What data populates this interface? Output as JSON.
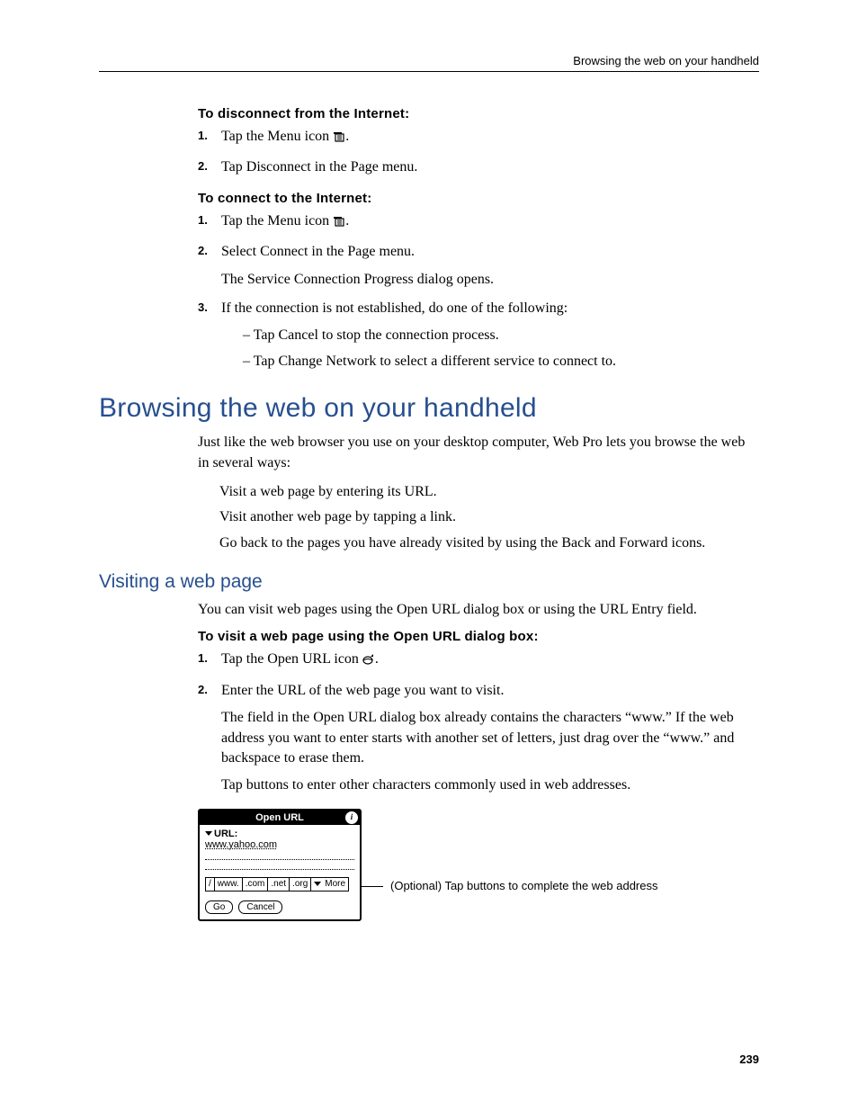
{
  "header": {
    "running": "Browsing the web on your handheld"
  },
  "proc1": {
    "title": "To disconnect from the Internet:",
    "s1": "Tap the Menu icon ",
    "s1_tail": ".",
    "s2": "Tap Disconnect in the Page menu."
  },
  "proc2": {
    "title": "To connect to the Internet:",
    "s1": "Tap the Menu icon ",
    "s1_tail": ".",
    "s2": "Select Connect in the Page menu.",
    "s2_follow": "The Service Connection Progress dialog opens.",
    "s3": "If the connection is not established, do one of the following:",
    "s3a": "Tap Cancel to stop the connection process.",
    "s3b": "Tap Change Network to select a different service to connect to."
  },
  "h1": "Browsing the web on your handheld",
  "intro": "Just like the web browser you use on your desktop computer, Web Pro lets you browse the web in several ways:",
  "b1": "Visit a web page by entering its URL.",
  "b2": "Visit another web page by tapping a link.",
  "b3": "Go back to the pages you have already visited by using the Back and Forward icons.",
  "h2": "Visiting a web page",
  "visit_intro": "You can visit web pages using the Open URL dialog box or using the URL Entry field.",
  "proc3": {
    "title": "To visit a web page using the Open URL dialog box:",
    "s1": "Tap the Open URL icon ",
    "s1_tail": ".",
    "s2": "Enter the URL of the web page you want to visit.",
    "s2_follow1": "The field in the Open URL dialog box already contains the characters “www.” If the web address you want to enter starts with another set of letters, just drag over the “www.” and backspace to erase them.",
    "s2_follow2": "Tap buttons to enter other characters commonly used in web addresses."
  },
  "dialog": {
    "title": "Open URL",
    "label": "URL:",
    "value": "www.yahoo.com",
    "btns": {
      "slash": "/",
      "www": "www.",
      "com": ".com",
      "net": ".net",
      "org": ".org",
      "more": "More"
    },
    "go": "Go",
    "cancel": "Cancel"
  },
  "callout": "(Optional) Tap buttons to complete the web address",
  "pagenum": "239",
  "nums": {
    "n1": "1.",
    "n2": "2.",
    "n3": "3."
  },
  "dash": "–  "
}
